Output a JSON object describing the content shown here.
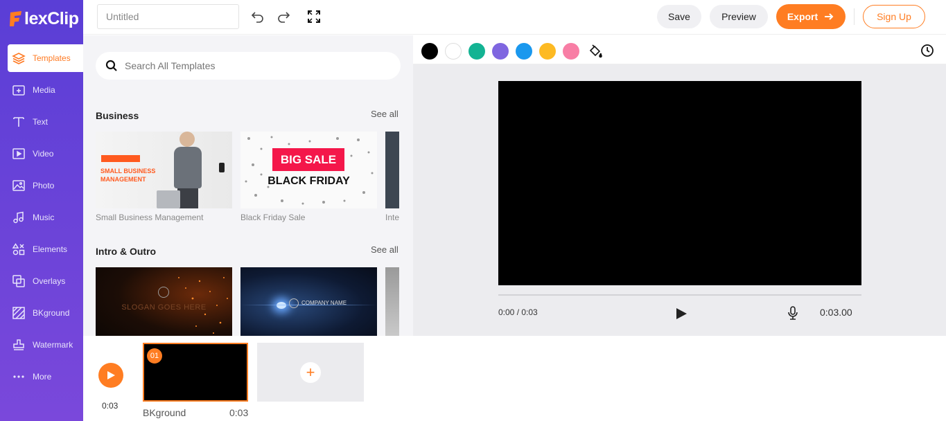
{
  "app": {
    "logo_text": "lexClip",
    "logo_letter": "F"
  },
  "sidebar": {
    "items": [
      {
        "label": "Templates",
        "icon": "layers-icon",
        "active": true
      },
      {
        "label": "Media",
        "icon": "folder-plus-icon"
      },
      {
        "label": "Text",
        "icon": "text-icon"
      },
      {
        "label": "Video",
        "icon": "video-icon"
      },
      {
        "label": "Photo",
        "icon": "photo-icon"
      },
      {
        "label": "Music",
        "icon": "music-icon"
      },
      {
        "label": "Elements",
        "icon": "elements-icon"
      },
      {
        "label": "Overlays",
        "icon": "overlays-icon"
      },
      {
        "label": "BKground",
        "icon": "background-icon"
      },
      {
        "label": "Watermark",
        "icon": "stamp-icon"
      },
      {
        "label": "More",
        "icon": "more-icon"
      }
    ]
  },
  "header": {
    "title_value": "Untitled",
    "save_label": "Save",
    "preview_label": "Preview",
    "export_label": "Export",
    "signup_label": "Sign Up"
  },
  "templates": {
    "search_placeholder": "Search All Templates",
    "sections": [
      {
        "title": "Business",
        "see_all": "See all",
        "items": [
          {
            "label": "Small Business Management",
            "text_lines": [
              "SMALL BUSINESS",
              "MANAGEMENT"
            ]
          },
          {
            "label": "Black Friday Sale",
            "text_lines": [
              "BIG SALE",
              "BLACK FRIDAY"
            ]
          },
          {
            "label": "Inte"
          }
        ]
      },
      {
        "title": "Intro & Outro",
        "see_all": "See all",
        "items": [
          {
            "label": "",
            "text_lines": [
              "SLOGAN GOES HERE"
            ]
          },
          {
            "label": "",
            "text_lines": [
              "COMPANY NAME"
            ]
          },
          {
            "label": ""
          }
        ]
      }
    ]
  },
  "toolbar": {
    "colors": [
      "#000000",
      "#ffffff",
      "#13b393",
      "#7f66e0",
      "#1a98ee",
      "#fdba23",
      "#f87ea5"
    ],
    "fill_icon": "paint-bucket-icon",
    "history_icon": "clock-icon"
  },
  "player": {
    "time_readout": "0:00 / 0:03",
    "duration": "0:03.00",
    "progress": 0
  },
  "timeline": {
    "time": "0:03",
    "scenes": [
      {
        "badge": "01",
        "name": "BKground",
        "duration": "0:03"
      }
    ],
    "add_label": "+"
  }
}
